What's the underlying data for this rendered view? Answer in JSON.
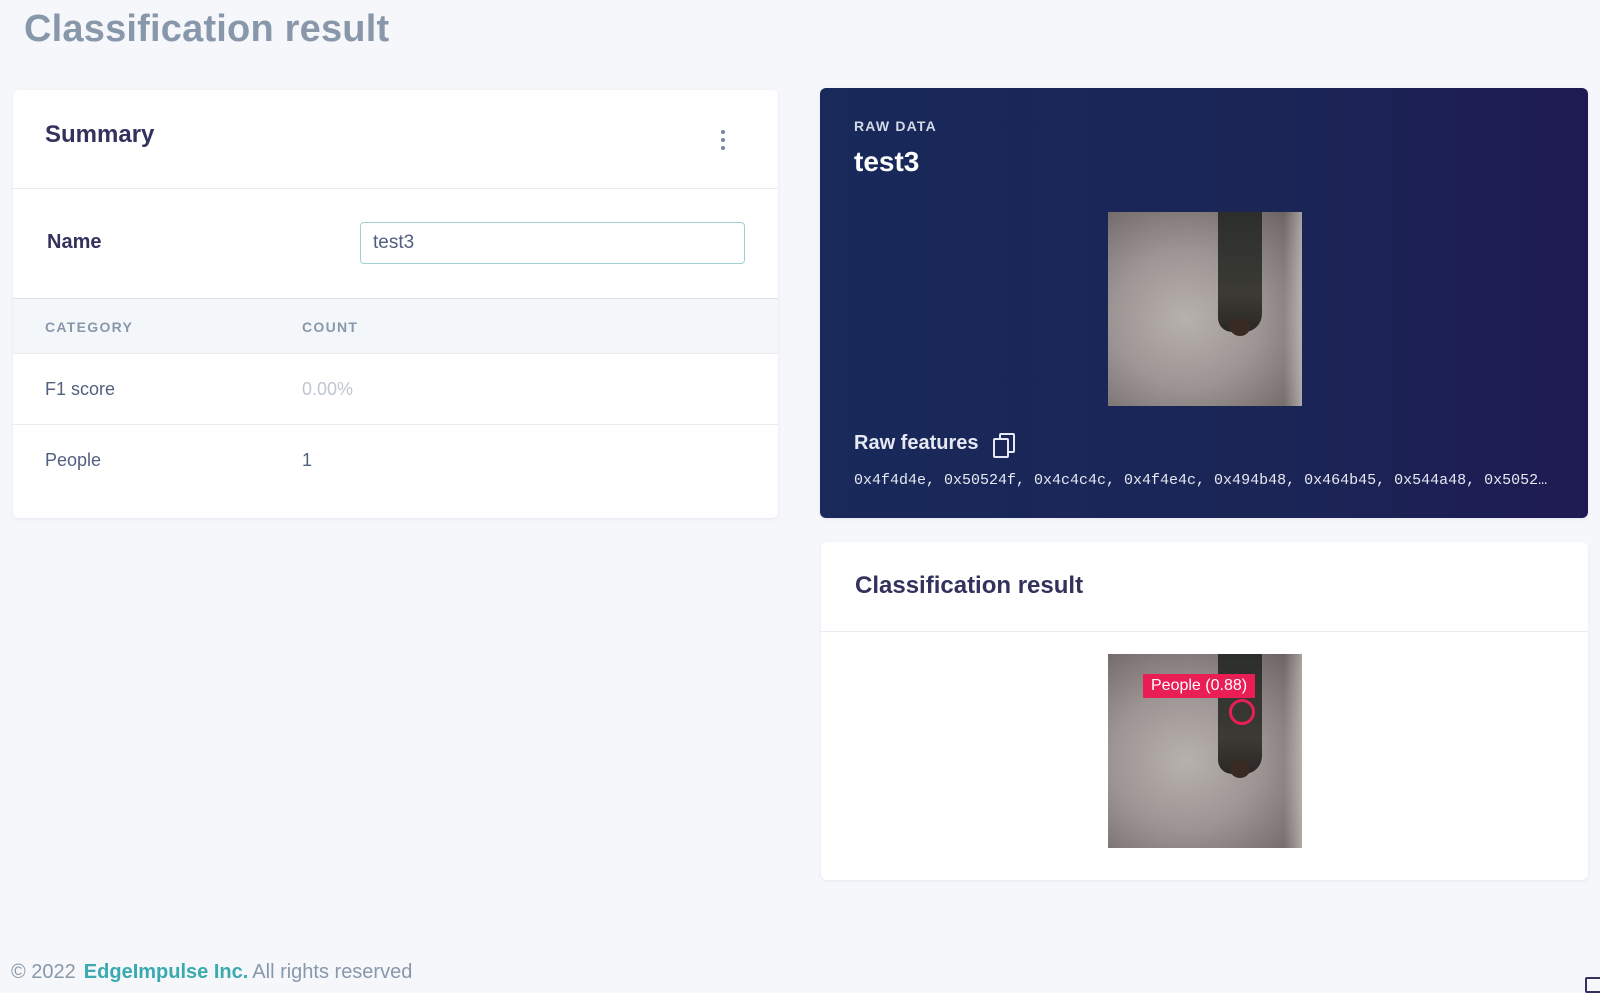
{
  "page": {
    "title": "Classification result"
  },
  "summary": {
    "title": "Summary",
    "name_label": "Name",
    "name_value": "test3",
    "columns": [
      "CATEGORY",
      "COUNT"
    ],
    "rows": [
      {
        "category": "F1 score",
        "count": "0.00%"
      },
      {
        "category": "People",
        "count": "1"
      }
    ]
  },
  "raw_data": {
    "label": "RAW DATA",
    "name": "test3",
    "features_label": "Raw features",
    "features_text": "0x4f4d4e, 0x50524f, 0x4c4c4c, 0x4f4e4c, 0x494b48, 0x464b45, 0x544a48, 0x5052…"
  },
  "classification": {
    "title": "Classification result",
    "detection_label": "People (0.88)",
    "detection_color": "#e91e55"
  },
  "footer": {
    "copyright": "© 2022",
    "company": "EdgeImpulse Inc.",
    "rights": "All rights reserved"
  }
}
